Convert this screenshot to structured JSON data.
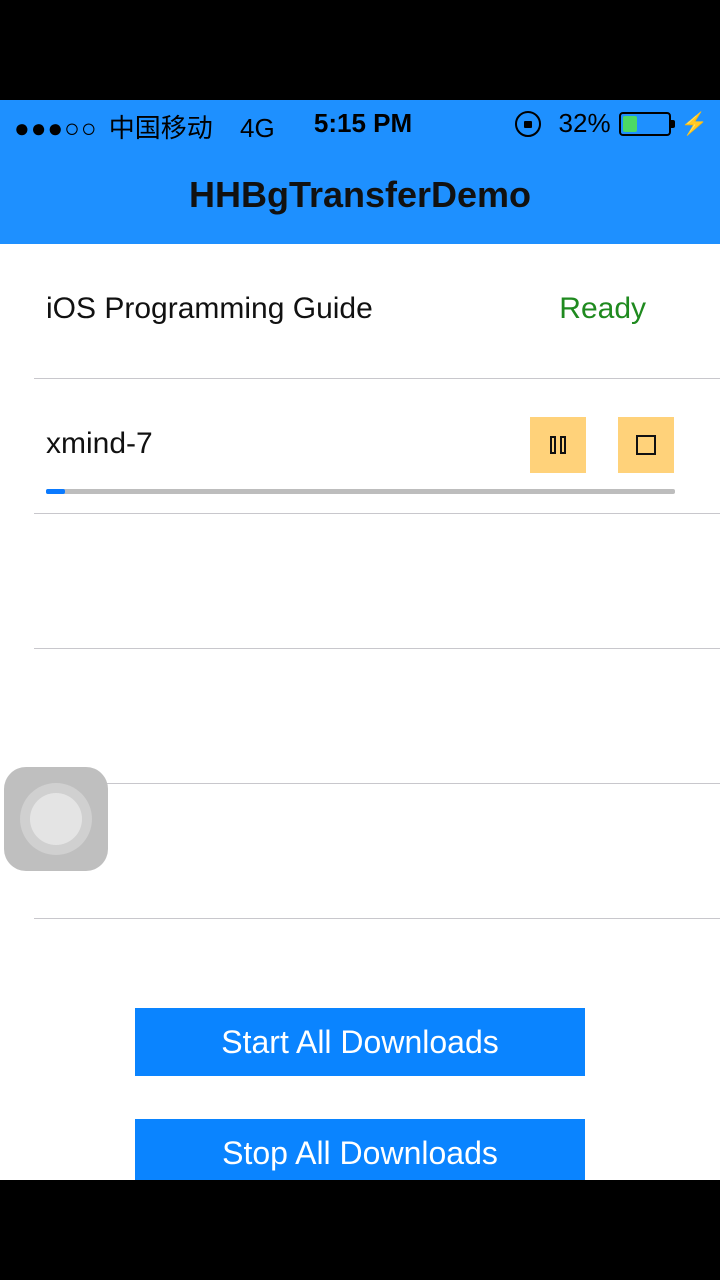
{
  "status_bar": {
    "signal": "●●●○○",
    "carrier": "中国移动",
    "network": "4G",
    "time": "5:15 PM",
    "battery_percent": "32%",
    "battery_level": 0.32
  },
  "nav": {
    "title": "HHBgTransferDemo"
  },
  "downloads": [
    {
      "name": "iOS Programming Guide",
      "status": "Ready"
    },
    {
      "name": "xmind-7",
      "progress": 0.03
    }
  ],
  "buttons": {
    "start_all": "Start All Downloads",
    "stop_all": "Stop All Downloads"
  },
  "colors": {
    "nav_background": "#1E90FF",
    "status_ready": "#1F8A1F",
    "control_button": "#FFD27A",
    "primary_button": "#0A84FF"
  }
}
